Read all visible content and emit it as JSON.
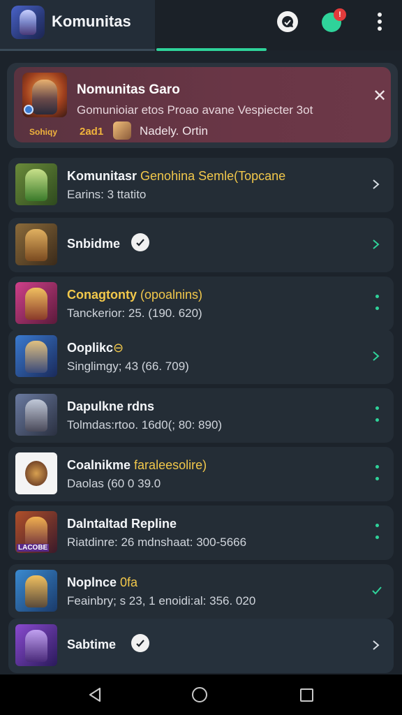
{
  "header": {
    "title": "Komunitas",
    "notification_count": "!"
  },
  "featured": {
    "title": "Nomunitas Garo",
    "subtitle": "Gomunioiar etos Proao avane Vespiecter 3ot",
    "tag": "Sohiqy",
    "year": "2ad1",
    "author": "Nadely. Ortin"
  },
  "items": [
    {
      "title": "Komunitasr",
      "title_highlight": "Genohina Semle(Topcane",
      "subtitle": "Earins: 3 ttatito",
      "action": "chevron"
    },
    {
      "title": "Snbidme",
      "subtitle": "",
      "action": "chevron-green",
      "verified": true
    },
    {
      "title": "Conagtonty",
      "title_highlight": "(opoalnins)",
      "subtitle": "Tanckerior: 25. (190. 620)",
      "action": "dots"
    },
    {
      "title": "Ooplikc",
      "title_highlight": "⊖",
      "subtitle": "Singlimgy; 43 (66. 709)",
      "action": "chevron-green"
    },
    {
      "title": "Dapulkne rdns",
      "subtitle": "Tolmdas:rtoo. 16d0(; 80: 890)",
      "action": "dots"
    },
    {
      "title": "Coalnikme",
      "title_highlight": "faraleesolire)",
      "subtitle": "Daolas (60 0 39.0",
      "action": "dots"
    },
    {
      "title": "Dalntaltad Repline",
      "subtitle": "Riatdinre: 26 mdnshaat: 300-5666",
      "action": "dots"
    },
    {
      "title": "Noplnce",
      "title_highlight": "0fa",
      "subtitle": "Feainbry; s 23, 1 enoidi:al: 356. 020",
      "action": "check"
    },
    {
      "title": "Sabtime",
      "subtitle": "",
      "action": "chevron",
      "verified": true
    }
  ],
  "thumb_labels": {
    "item7": "LACOBE"
  },
  "colors": {
    "accent": "#2fd39a",
    "highlight": "#f2c84b",
    "featured_bg": "#66364a",
    "row_bg": "#242d36",
    "badge": "#e23b3b"
  }
}
